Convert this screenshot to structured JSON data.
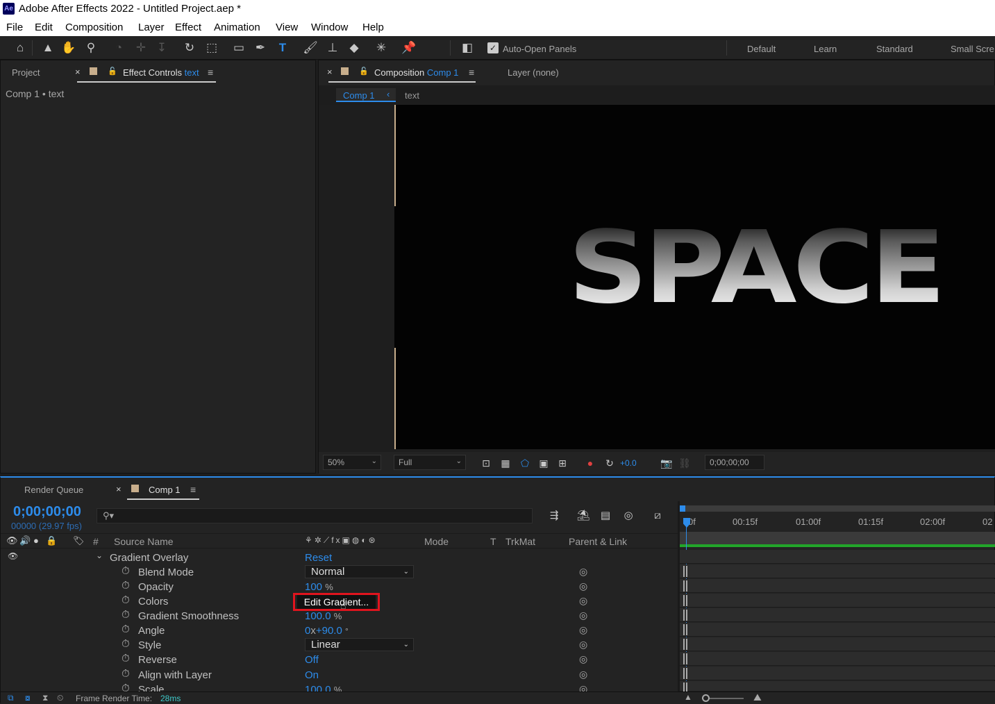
{
  "app": {
    "title": "Adobe After Effects 2022 - Untitled Project.aep *",
    "logo": "Ae"
  },
  "menu": [
    "File",
    "Edit",
    "Composition",
    "Layer",
    "Effect",
    "Animation",
    "View",
    "Window",
    "Help"
  ],
  "toolbar": {
    "auto_open_label": "Auto-Open Panels",
    "auto_open_checked": true,
    "workspaces": [
      "Default",
      "Learn",
      "Standard",
      "Small Scre"
    ]
  },
  "left_panel": {
    "tab_project": "Project",
    "tab_effect_controls": "Effect Controls",
    "tab_effect_controls_target": "text",
    "layer_path": "Comp 1 • text"
  },
  "comp_panel": {
    "tab_composition": "Composition",
    "tab_comp_name": "Comp 1",
    "tab_layer": "Layer (none)",
    "breadcrumb_comp": "Comp 1",
    "breadcrumb_layer": "text",
    "canvas_text": "SPACE",
    "zoom": "50%",
    "resolution": "Full",
    "exposure": "+0.0",
    "timecode": "0;00;00;00"
  },
  "timeline": {
    "tab_render_queue": "Render Queue",
    "tab_comp": "Comp 1",
    "timecode": "0;00;00;00",
    "frame_info": "00000 (29.97 fps)",
    "search_placeholder": "",
    "col_num": "#",
    "col_source": "Source Name",
    "col_mode": "Mode",
    "col_t": "T",
    "col_trkmat": "TrkMat",
    "col_parent": "Parent & Link",
    "ruler": [
      "0f",
      "00:15f",
      "01:00f",
      "01:15f",
      "02:00f",
      "02"
    ],
    "effect_name": "Gradient Overlay",
    "effect_reset": "Reset",
    "properties": [
      {
        "name": "Blend Mode",
        "type": "dropdown",
        "value": "Normal"
      },
      {
        "name": "Opacity",
        "type": "number",
        "value": "100",
        "unit": "%"
      },
      {
        "name": "Colors",
        "type": "button",
        "value": "Edit Gradient..."
      },
      {
        "name": "Gradient Smoothness",
        "type": "number",
        "value": "100.0",
        "unit": "%"
      },
      {
        "name": "Angle",
        "type": "angle",
        "value": "0",
        "sep": "x",
        "value2": "+90.0",
        "unit": "°"
      },
      {
        "name": "Style",
        "type": "dropdown",
        "value": "Linear"
      },
      {
        "name": "Reverse",
        "type": "number",
        "value": "Off",
        "unit": ""
      },
      {
        "name": "Align with Layer",
        "type": "number",
        "value": "On",
        "unit": ""
      },
      {
        "name": "Scale",
        "type": "number",
        "value": "100.0",
        "unit": "%"
      }
    ],
    "status_label": "Frame Render Time:",
    "status_value": "28ms"
  },
  "colors": {
    "accent": "#2d8ceb",
    "highlight": "#e0141e",
    "work_area": "#22a52a"
  }
}
